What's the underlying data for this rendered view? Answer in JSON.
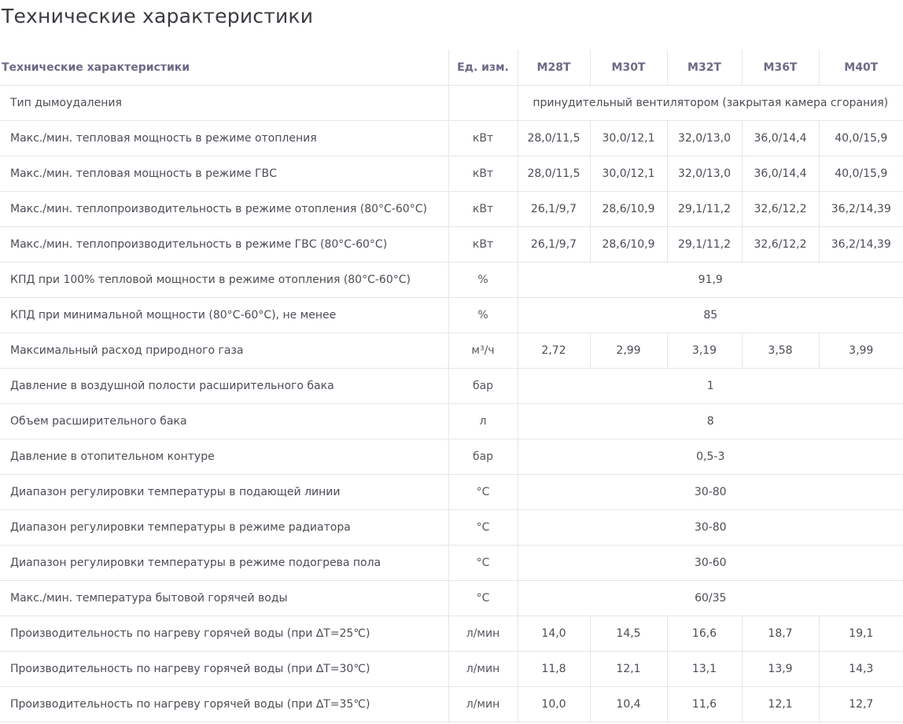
{
  "page": {
    "title": "Технические характеристики"
  },
  "table": {
    "headers": {
      "name": "Технические характеристики",
      "unit": "Ед. изм.",
      "models": [
        "M28T",
        "M30T",
        "M32T",
        "M36T",
        "M40T"
      ]
    },
    "rows": [
      {
        "name": "Тип дымоудаления",
        "unit": "",
        "values": [
          "принудительный вентилятором (закрытая камера сгорания)"
        ]
      },
      {
        "name": "Макс./мин. тепловая мощность в режиме отопления",
        "unit": "кВт",
        "values": [
          "28,0/11,5",
          "30,0/12,1",
          "32,0/13,0",
          "36,0/14,4",
          "40,0/15,9"
        ]
      },
      {
        "name": "Макс./мин. тепловая мощность в режиме ГВС",
        "unit": "кВт",
        "values": [
          "28,0/11,5",
          "30,0/12,1",
          "32,0/13,0",
          "36,0/14,4",
          "40,0/15,9"
        ]
      },
      {
        "name": "Макс./мин. теплопроизводительность в режиме отопления (80°С-60°С)",
        "unit": "кВт",
        "values": [
          "26,1/9,7",
          "28,6/10,9",
          "29,1/11,2",
          "32,6/12,2",
          "36,2/14,39"
        ]
      },
      {
        "name": "Макс./мин. теплопроизводительность в режиме ГВС (80°С-60°С)",
        "unit": "кВт",
        "values": [
          "26,1/9,7",
          "28,6/10,9",
          "29,1/11,2",
          "32,6/12,2",
          "36,2/14,39"
        ]
      },
      {
        "name": "КПД при 100% тепловой мощности в режиме отопления (80°С-60°С)",
        "unit": "%",
        "values": [
          "91,9"
        ]
      },
      {
        "name": "КПД при минимальной мощности (80°С-60°С), не менее",
        "unit": "%",
        "values": [
          "85"
        ]
      },
      {
        "name": "Максимальный  расход природного газа",
        "unit": "м³/ч",
        "values": [
          "2,72",
          "2,99",
          "3,19",
          "3,58",
          "3,99"
        ]
      },
      {
        "name": "Давление в воздушной полости расширительного бака",
        "unit": "бар",
        "values": [
          "1"
        ]
      },
      {
        "name": "Объем расширительного бака",
        "unit": "л",
        "values": [
          "8"
        ]
      },
      {
        "name": "Давление в отопительном контуре",
        "unit": "бар",
        "values": [
          "0,5-3"
        ]
      },
      {
        "name": "Диапазон регулировки температуры в подающей линии",
        "unit": "°С",
        "values": [
          "30-80"
        ]
      },
      {
        "name": "Диапазон регулировки температуры в режиме радиатора",
        "unit": "°С",
        "values": [
          "30-80"
        ]
      },
      {
        "name": "Диапазон регулировки температуры в режиме подогрева пола",
        "unit": "°С",
        "values": [
          "30-60"
        ]
      },
      {
        "name": "Макс./мин. температура бытовой горячей воды",
        "unit": "°С",
        "values": [
          "60/35"
        ]
      },
      {
        "name": "Производительность по нагреву горячей воды   (при ∆Т=25℃)",
        "unit": "л/мин",
        "values": [
          "14,0",
          "14,5",
          "16,6",
          "18,7",
          "19,1"
        ]
      },
      {
        "name": "Производительность по нагреву горячей воды  (при ∆Т=30℃)",
        "unit": "л/мин",
        "values": [
          "11,8",
          "12,1",
          "13,1",
          "13,9",
          "14,3"
        ]
      },
      {
        "name": "Производительность по нагреву горячей воды  (при ∆Т=35℃)",
        "unit": "л/мин",
        "values": [
          "10,0",
          "10,4",
          "11,6",
          "12,1",
          "12,7"
        ]
      }
    ]
  }
}
